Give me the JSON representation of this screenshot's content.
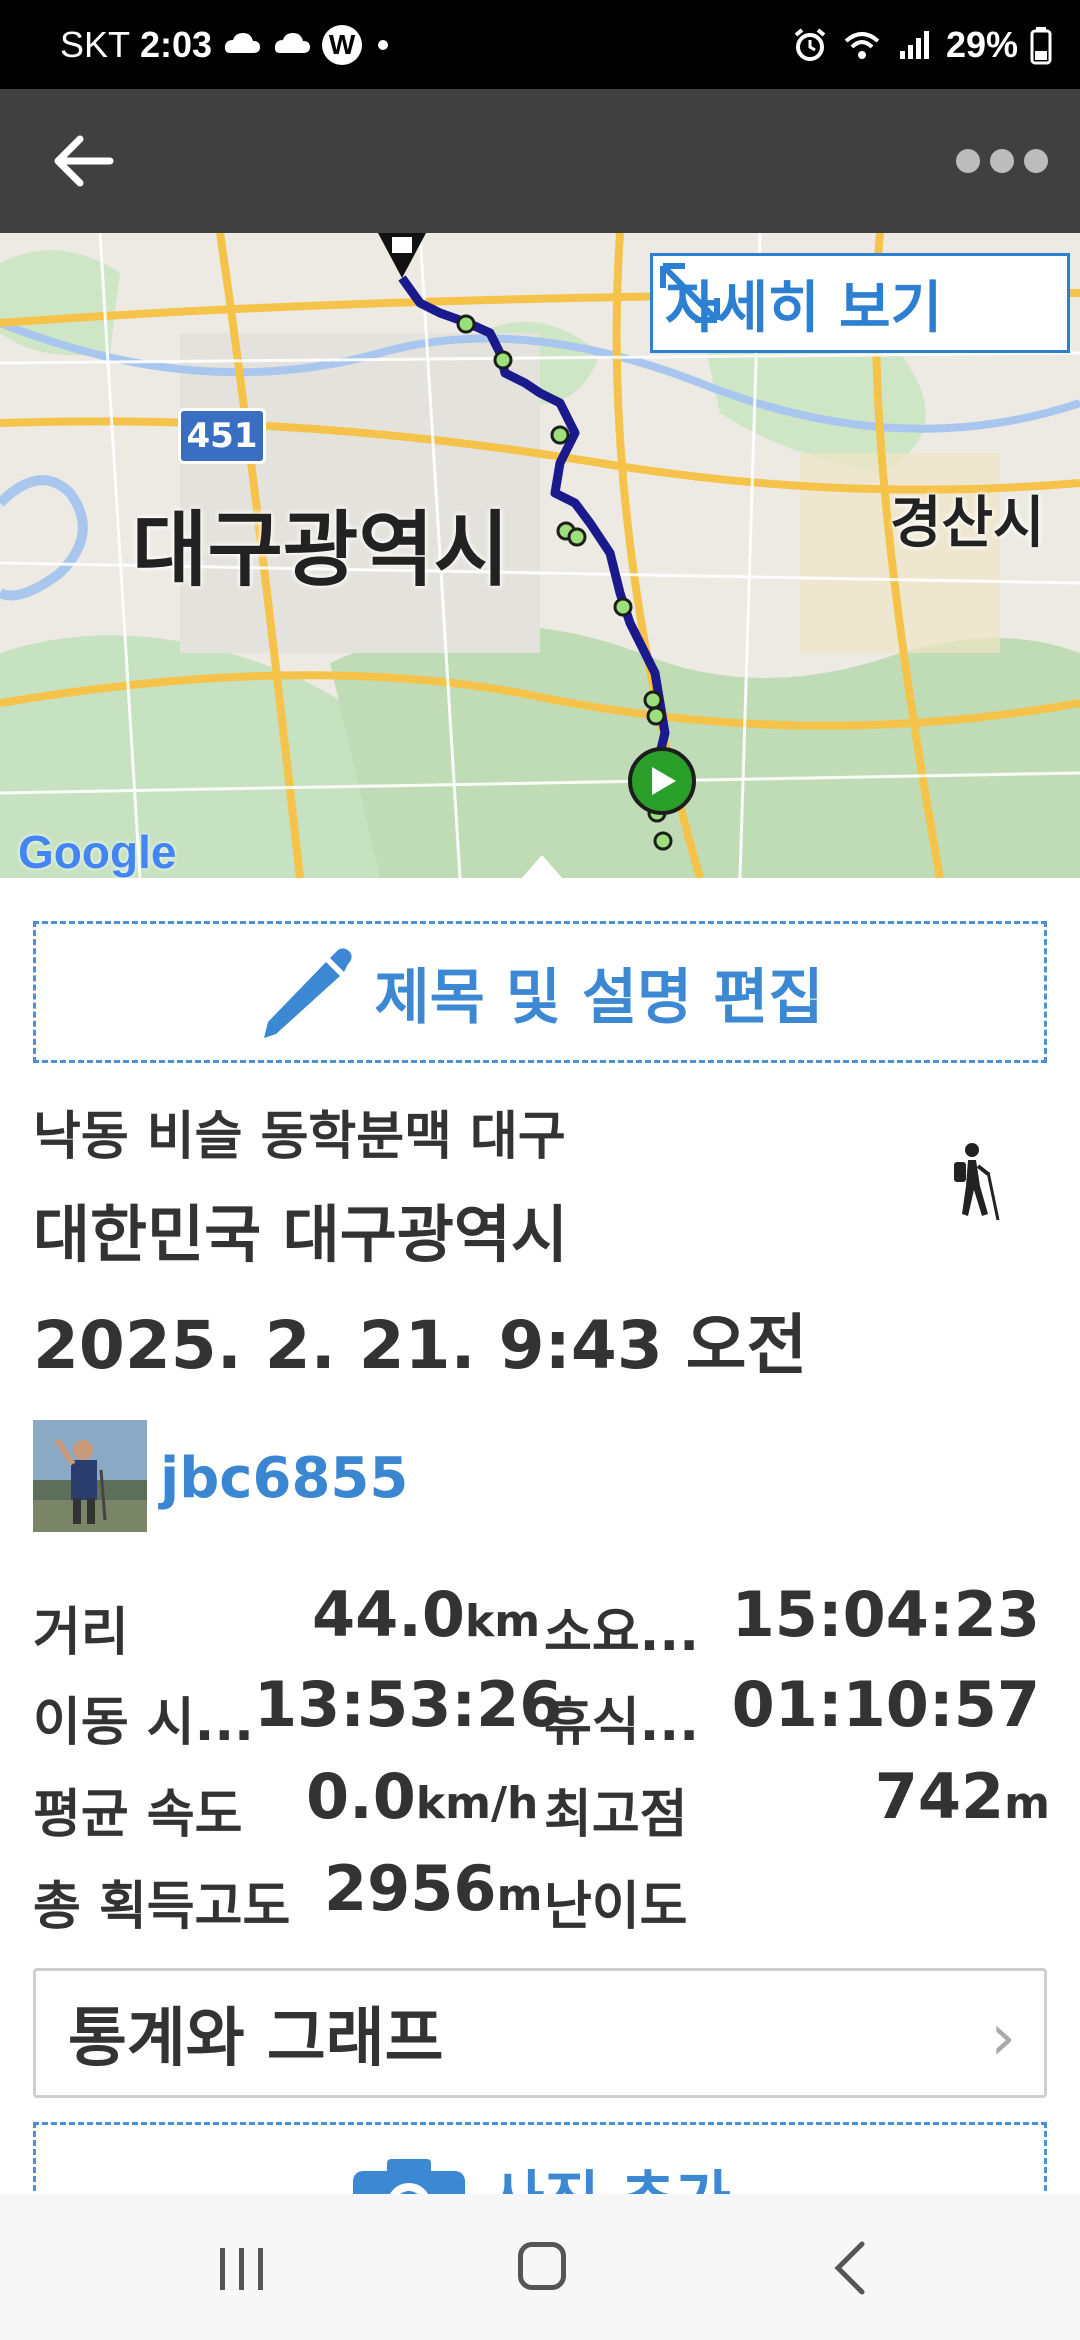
{
  "status_bar": {
    "carrier": "SKT",
    "time": "2:03",
    "notif_badge": "W",
    "battery": "29%"
  },
  "toolbar": {
    "back_icon": "arrow-left-icon",
    "more_icon": "more-dots-icon"
  },
  "map": {
    "detail_button_label": "자세히 보기",
    "city_label_1": "대구광역시",
    "city_label_2": "경산시",
    "highway_shield": "451",
    "attribution": "Google"
  },
  "edit_button": {
    "label": "제목 및 설명 편집"
  },
  "trail": {
    "name": "낙동 비슬 동학분맥 대구",
    "location": "대한민국 대구광역시",
    "date": "2025. 2. 21. 9:43 오전",
    "activity_icon": "hiking-icon"
  },
  "user": {
    "username": "jbc6855"
  },
  "stats": {
    "distance_label": "거리",
    "distance_value": "44.0",
    "distance_unit": "km",
    "duration_label": "소요...",
    "duration_value": "15:04:23",
    "moving_label": "이동 시...",
    "moving_value": "13:53:26",
    "rest_label": "휴식...",
    "rest_value": "01:10:57",
    "avg_speed_label": "평균 속도",
    "avg_speed_value": "0.0",
    "avg_speed_unit": "km/h",
    "highest_label": "최고점",
    "highest_value": "742",
    "highest_unit": "m",
    "gain_label": "총 획득고도",
    "gain_value": "2956",
    "gain_unit": "m",
    "difficulty_label": "난이도"
  },
  "stats_button": {
    "label": "통계와 그래프",
    "chevron": "›"
  },
  "photo_button": {
    "label": "사진 추가"
  },
  "colors": {
    "accent": "#3c88d2",
    "route": "#1a1a8c",
    "toolbar": "#404040"
  }
}
